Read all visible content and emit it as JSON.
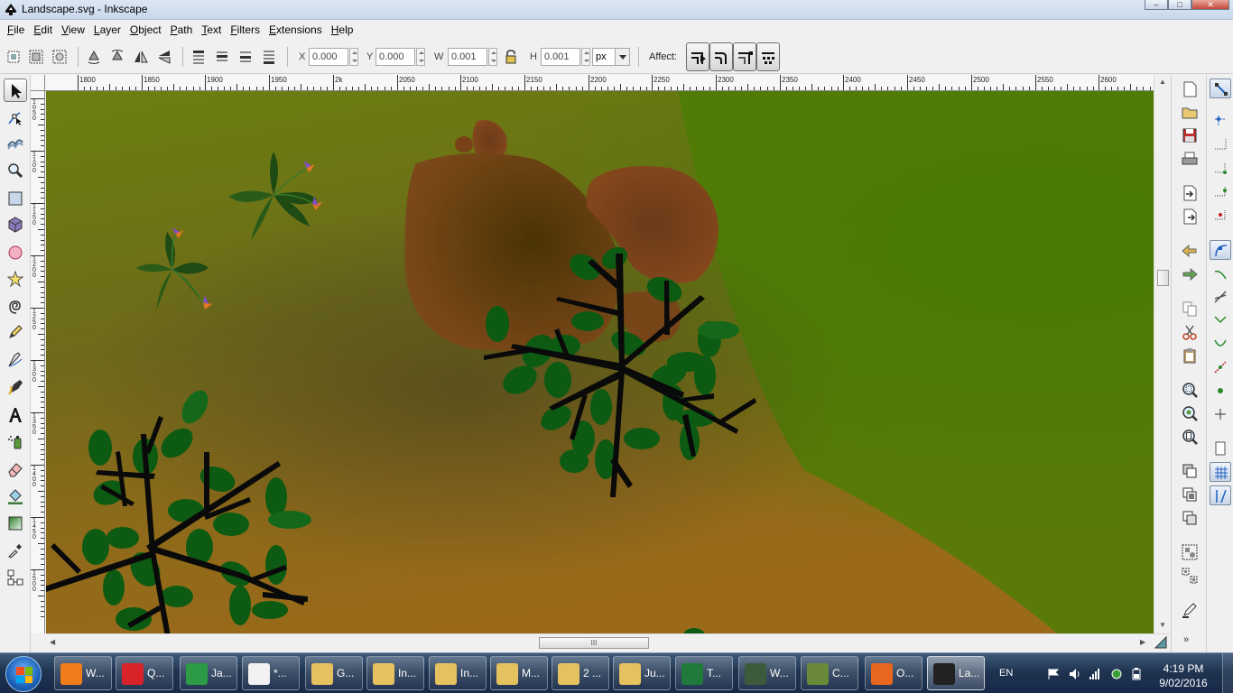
{
  "window": {
    "title": "Landscape.svg - Inkscape",
    "minimize_glyph": "–",
    "maximize_glyph": "□",
    "close_glyph": "✕"
  },
  "menubar": [
    {
      "label": "File",
      "key": "F",
      "rest": "ile"
    },
    {
      "label": "Edit",
      "key": "E",
      "rest": "dit"
    },
    {
      "label": "View",
      "key": "V",
      "rest": "iew"
    },
    {
      "label": "Layer",
      "key": "L",
      "rest": "ayer"
    },
    {
      "label": "Object",
      "key": "O",
      "rest": "bject"
    },
    {
      "label": "Path",
      "key": "P",
      "rest": "ath"
    },
    {
      "label": "Text",
      "key": "T",
      "rest": "ext"
    },
    {
      "label": "Filters",
      "key": "F",
      "rest": "ilters"
    },
    {
      "label": "Extensions",
      "key": "E",
      "rest": "xtensions"
    },
    {
      "label": "Help",
      "key": "H",
      "rest": "elp"
    }
  ],
  "tool_controls": {
    "x_label": "X",
    "x_value": "0.000",
    "y_label": "Y",
    "y_value": "0.000",
    "w_label": "W",
    "w_value": "0.001",
    "h_label": "H",
    "h_value": "0.001",
    "unit": "px",
    "affect_label": "Affect:"
  },
  "ruler_top": {
    "labels": [
      "1800",
      "1850",
      "1900",
      "1950",
      "2k",
      "2050",
      "2100",
      "2150",
      "2200",
      "2250",
      "2300",
      "2350",
      "2400",
      "2450",
      "2500",
      "2550",
      "2600"
    ]
  },
  "ruler_left": {
    "labels": [
      "1050",
      "1100",
      "1150",
      "1200",
      "1250",
      "1300",
      "1350",
      "1400",
      "1450",
      "1500"
    ]
  },
  "hscroll_grip": "III",
  "commands_more": "»",
  "tools": [
    "selector-tool",
    "node-tool",
    "tweak-tool",
    "zoom-tool",
    "rectangle-tool",
    "3d-box-tool",
    "ellipse-tool",
    "star-tool",
    "spiral-tool",
    "pencil-tool",
    "pen-tool",
    "calligraphy-tool",
    "text-tool",
    "spray-tool",
    "eraser-tool",
    "paint-bucket-tool",
    "gradient-tool",
    "dropper-tool",
    "connector-tool"
  ],
  "taskbar": {
    "items": [
      {
        "label": "W...",
        "color": "#f07c1a",
        "active": false
      },
      {
        "label": "Q...",
        "color": "#d8232a",
        "active": false
      },
      {
        "label": "Ja...",
        "color": "#2d9a45",
        "active": false
      },
      {
        "label": "*...",
        "color": "#f2f2f2",
        "active": false
      },
      {
        "label": "G...",
        "color": "#e5c160",
        "active": false
      },
      {
        "label": "In...",
        "color": "#e5c160",
        "active": false
      },
      {
        "label": "In...",
        "color": "#e5c160",
        "active": false
      },
      {
        "label": "M...",
        "color": "#e5c160",
        "active": false
      },
      {
        "label": "2 ...",
        "color": "#e5c160",
        "active": false
      },
      {
        "label": "Ju...",
        "color": "#e5c160",
        "active": false
      },
      {
        "label": "T...",
        "color": "#1f7a3c",
        "active": false
      },
      {
        "label": "W...",
        "color": "#3d5a3a",
        "active": false
      },
      {
        "label": "C...",
        "color": "#6a8a3a",
        "active": false
      },
      {
        "label": "O...",
        "color": "#e8661d",
        "active": false
      },
      {
        "label": "La...",
        "color": "#222222",
        "active": true
      }
    ],
    "language": "EN",
    "time": "4:19 PM",
    "date": "9/02/2016"
  }
}
